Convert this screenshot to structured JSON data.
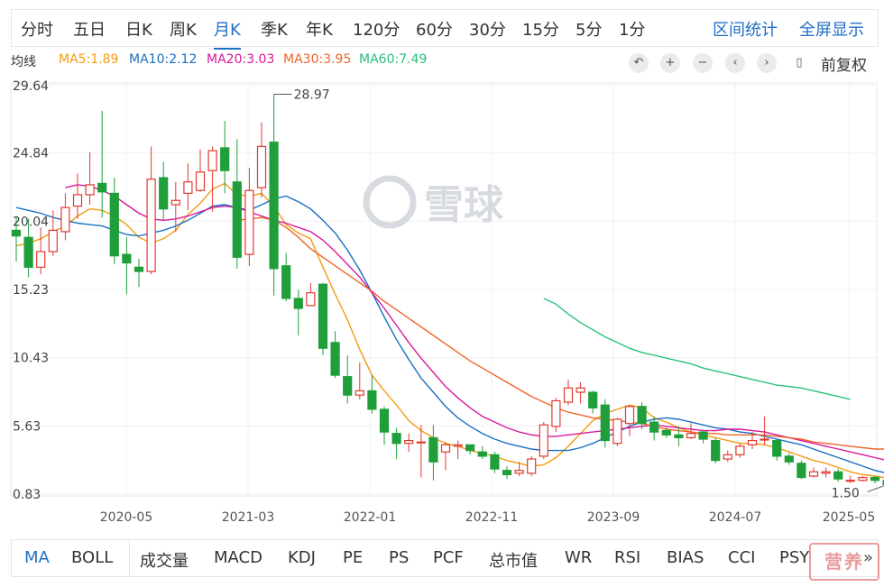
{
  "top_tabs": [
    "分时",
    "五日",
    "日K",
    "周K",
    "月K",
    "季K",
    "年K",
    "120分",
    "60分",
    "30分",
    "15分",
    "5分",
    "1分"
  ],
  "active_top_tab": "月K",
  "right_links": [
    "区间统计",
    "全屏显示"
  ],
  "ma_legend": {
    "title": "均线",
    "items": [
      {
        "label": "MA5:1.89",
        "color": "#f59a11"
      },
      {
        "label": "MA10:2.12",
        "color": "#1a6fc4"
      },
      {
        "label": "MA20:3.03",
        "color": "#d9189c"
      },
      {
        "label": "MA30:3.95",
        "color": "#f0642a"
      },
      {
        "label": "MA60:7.49",
        "color": "#27c07a"
      }
    ]
  },
  "toolbar": {
    "icons": [
      "undo-icon",
      "zoom-in-icon",
      "zoom-out-icon",
      "pan-left-icon",
      "pan-right-icon",
      "candle-type-icon"
    ],
    "restore_label": "前复权"
  },
  "watermark": "雪球",
  "chart_data": {
    "type": "candlestick",
    "y_ticks": [
      "29.64",
      "24.84",
      "20.04",
      "15.23",
      "10.43",
      "5.63",
      "0.83"
    ],
    "x_ticks": [
      "2020-05",
      "2021-03",
      "2022-01",
      "2022-11",
      "2023-09",
      "2024-07",
      "2025-05"
    ],
    "ylim": [
      0.83,
      29.64
    ],
    "high_label": "28.97",
    "low_label": "1.50",
    "up_color": "#e03a2f",
    "down_color": "#1f9e3a",
    "candles": [
      [
        19.4,
        19.0,
        20.4,
        17.2
      ],
      [
        18.9,
        16.8,
        20.2,
        16.1
      ],
      [
        16.8,
        17.9,
        19.6,
        16.3
      ],
      [
        17.9,
        19.4,
        20.8,
        17.6
      ],
      [
        19.3,
        21.0,
        22.0,
        18.7
      ],
      [
        21.1,
        21.9,
        23.4,
        20.2
      ],
      [
        21.9,
        22.6,
        24.9,
        21.2
      ],
      [
        22.7,
        22.1,
        27.8,
        20.3
      ],
      [
        22.0,
        17.6,
        23.1,
        17.0
      ],
      [
        17.7,
        17.1,
        18.9,
        14.9
      ],
      [
        16.8,
        16.5,
        17.4,
        15.4
      ],
      [
        16.5,
        23.0,
        25.3,
        16.3
      ],
      [
        23.1,
        20.9,
        24.2,
        20.1
      ],
      [
        21.2,
        21.5,
        22.8,
        19.3
      ],
      [
        22.0,
        22.8,
        24.1,
        20.8
      ],
      [
        22.2,
        23.5,
        25.1,
        22.1
      ],
      [
        23.6,
        25.0,
        25.3,
        20.7
      ],
      [
        25.2,
        23.6,
        27.1,
        22.0
      ],
      [
        22.8,
        17.5,
        25.8,
        16.7
      ],
      [
        17.7,
        22.2,
        23.8,
        16.9
      ],
      [
        22.4,
        25.3,
        27.0,
        21.7
      ],
      [
        25.6,
        16.7,
        28.97,
        14.8
      ],
      [
        16.9,
        14.6,
        17.8,
        14.4
      ],
      [
        14.6,
        13.9,
        15.2,
        12.0
      ],
      [
        14.1,
        15.0,
        15.7,
        14.3
      ],
      [
        15.6,
        11.1,
        15.7,
        10.6
      ],
      [
        11.5,
        9.2,
        12.3,
        9.0
      ],
      [
        9.1,
        7.8,
        10.6,
        7.2
      ],
      [
        7.8,
        8.1,
        10.1,
        7.5
      ],
      [
        8.1,
        6.8,
        9.2,
        6.5
      ],
      [
        6.8,
        5.2,
        7.0,
        4.3
      ],
      [
        5.1,
        4.4,
        5.5,
        3.3
      ],
      [
        4.4,
        4.6,
        5.1,
        3.8
      ],
      [
        4.5,
        4.5,
        5.7,
        2.0
      ],
      [
        4.8,
        3.1,
        5.7,
        1.8
      ],
      [
        3.8,
        4.3,
        4.5,
        2.5
      ],
      [
        4.2,
        4.3,
        4.6,
        3.3
      ],
      [
        4.3,
        3.9,
        4.1,
        3.6
      ],
      [
        3.8,
        3.5,
        4.2,
        3.3
      ],
      [
        3.6,
        2.6,
        3.8,
        2.3
      ],
      [
        2.5,
        2.2,
        2.8,
        1.9
      ],
      [
        2.3,
        2.5,
        3.1,
        2.1
      ],
      [
        2.3,
        3.3,
        3.5,
        2.1
      ],
      [
        3.5,
        5.7,
        5.9,
        3.3
      ],
      [
        5.6,
        7.4,
        7.6,
        5.2
      ],
      [
        7.3,
        8.3,
        8.9,
        7.1
      ],
      [
        8.0,
        8.3,
        8.7,
        7.2
      ],
      [
        8.0,
        6.9,
        8.1,
        6.5
      ],
      [
        7.1,
        4.6,
        7.5,
        4.1
      ],
      [
        4.4,
        6.1,
        6.2,
        4.2
      ],
      [
        5.8,
        7.0,
        7.1,
        4.9
      ],
      [
        7.0,
        5.8,
        7.3,
        5.4
      ],
      [
        5.9,
        5.2,
        6.3,
        4.6
      ],
      [
        5.3,
        5.0,
        5.5,
        4.8
      ],
      [
        5.0,
        4.8,
        5.6,
        4.2
      ],
      [
        4.8,
        5.1,
        5.8,
        4.7
      ],
      [
        5.2,
        4.7,
        5.3,
        4.4
      ],
      [
        4.6,
        3.2,
        4.8,
        3.0
      ],
      [
        3.3,
        3.6,
        3.9,
        3.1
      ],
      [
        3.6,
        4.2,
        4.4,
        3.4
      ],
      [
        4.3,
        4.6,
        5.2,
        4.0
      ],
      [
        4.7,
        4.7,
        6.3,
        4.3
      ],
      [
        4.6,
        3.5,
        4.7,
        3.2
      ],
      [
        3.5,
        3.1,
        3.7,
        2.9
      ],
      [
        3.0,
        2.0,
        3.2,
        1.9
      ],
      [
        2.1,
        2.4,
        2.7,
        2.0
      ],
      [
        2.3,
        2.4,
        2.7,
        2.0
      ],
      [
        2.4,
        1.9,
        2.6,
        1.7
      ],
      [
        1.8,
        1.8,
        2.1,
        1.6
      ],
      [
        1.8,
        2.0,
        2.1,
        1.7
      ],
      [
        2.0,
        1.8,
        2.1,
        1.6
      ],
      [
        1.8,
        1.5,
        1.9,
        1.5
      ],
      [
        1.5,
        1.5,
        1.6,
        1.5
      ]
    ],
    "ma_lines": [
      {
        "name": "MA5",
        "color": "#f59a11",
        "start": 0,
        "values": [
          18.3,
          18.5,
          18.8,
          19.3,
          19.7,
          20.4,
          20.9,
          20.8,
          20.4,
          19.8,
          18.9,
          18.5,
          18.8,
          19.4,
          20.5,
          21.3,
          22.3,
          22.7,
          21.9,
          21.8,
          22.0,
          21.1,
          19.8,
          19.2,
          18.8,
          16.8,
          14.9,
          13.1,
          11.0,
          9.2,
          8.1,
          7.1,
          6.0,
          5.3,
          4.8,
          4.4,
          4.2,
          3.9,
          3.7,
          3.5,
          3.2,
          3.0,
          2.8,
          2.9,
          3.4,
          4.2,
          5.1,
          6.0,
          6.5,
          6.8,
          7.1,
          6.9,
          6.2,
          5.9,
          5.5,
          5.2,
          5.0,
          4.8,
          4.6,
          4.4,
          4.4,
          4.3,
          4.1,
          3.8,
          3.5,
          3.2,
          3.0,
          2.7,
          2.4,
          2.2,
          2.1,
          1.95,
          1.89
        ]
      },
      {
        "name": "MA10",
        "color": "#1a6fc4",
        "start": 0,
        "values": [
          21.0,
          20.8,
          20.6,
          20.3,
          20.1,
          19.9,
          19.8,
          19.7,
          19.4,
          19.1,
          19.0,
          19.2,
          19.4,
          19.7,
          20.1,
          20.6,
          21.1,
          21.2,
          21.0,
          20.8,
          21.2,
          21.6,
          21.8,
          21.4,
          20.9,
          20.1,
          19.2,
          18.0,
          16.6,
          15.0,
          13.3,
          11.7,
          10.3,
          9.0,
          8.0,
          7.0,
          6.2,
          5.6,
          5.1,
          4.7,
          4.4,
          4.2,
          4.0,
          3.9,
          3.9,
          3.9,
          4.1,
          4.4,
          4.8,
          5.2,
          5.6,
          5.9,
          6.1,
          6.2,
          6.1,
          5.9,
          5.7,
          5.5,
          5.4,
          5.2,
          5.1,
          4.9,
          4.7,
          4.5,
          4.3,
          4.0,
          3.7,
          3.4,
          3.1,
          2.8,
          2.5,
          2.3,
          2.12
        ]
      },
      {
        "name": "MA20",
        "color": "#d9189c",
        "start": 4,
        "values": [
          22.4,
          22.6,
          22.5,
          22.2,
          21.8,
          21.2,
          20.6,
          20.2,
          20.1,
          20.2,
          20.4,
          20.7,
          21.0,
          21.1,
          21.0,
          20.7,
          20.4,
          20.1,
          19.9,
          19.6,
          19.3,
          18.7,
          17.9,
          17.0,
          16.1,
          15.0,
          13.9,
          12.7,
          11.5,
          10.4,
          9.4,
          8.4,
          7.6,
          6.9,
          6.3,
          5.9,
          5.5,
          5.2,
          5.0,
          4.9,
          4.9,
          5.0,
          5.1,
          5.2,
          5.3,
          5.4,
          5.5,
          5.6,
          5.7,
          5.6,
          5.5,
          5.4,
          5.3,
          5.3,
          5.4,
          5.4,
          5.3,
          5.2,
          5.0,
          4.8,
          4.6,
          4.4,
          4.2,
          4.0,
          3.8,
          3.6,
          3.4,
          3.2,
          3.03
        ]
      },
      {
        "name": "MA30",
        "color": "#f0642a",
        "start": 18,
        "values": [
          20.1,
          20.2,
          20.3,
          20.1,
          19.6,
          18.9,
          18.1,
          17.5,
          16.9,
          16.3,
          15.7,
          15.1,
          14.4,
          13.8,
          13.2,
          12.6,
          12.0,
          11.4,
          10.8,
          10.2,
          9.7,
          9.2,
          8.7,
          8.2,
          7.7,
          7.3,
          6.9,
          6.6,
          6.4,
          6.2,
          6.1,
          6.0,
          5.9,
          5.8,
          5.6,
          5.4,
          5.3,
          5.2,
          5.1,
          5.1,
          5.0,
          5.0,
          5.0,
          5.0,
          4.9,
          4.8,
          4.7,
          4.5,
          4.4,
          4.3,
          4.2,
          4.1,
          4.0,
          4.0,
          3.95
        ]
      },
      {
        "name": "MA60",
        "color": "#27c07a",
        "start": 43,
        "values": [
          14.6,
          14.2,
          13.5,
          12.9,
          12.4,
          11.9,
          11.5,
          11.1,
          10.8,
          10.6,
          10.4,
          10.2,
          10.0,
          9.7,
          9.5,
          9.3,
          9.1,
          8.9,
          8.7,
          8.5,
          8.4,
          8.3,
          8.1,
          7.9,
          7.7,
          7.49
        ]
      }
    ]
  },
  "bottom_tabs": [
    "MA",
    "BOLL",
    "成交量",
    "MACD",
    "KDJ",
    "PE",
    "PS",
    "PCF",
    "总市值",
    "WR",
    "RSI",
    "BIAS",
    "CCI",
    "PSY"
  ],
  "active_bottom_tab": "MA",
  "expand_label": "»",
  "stamp_text": "营养"
}
